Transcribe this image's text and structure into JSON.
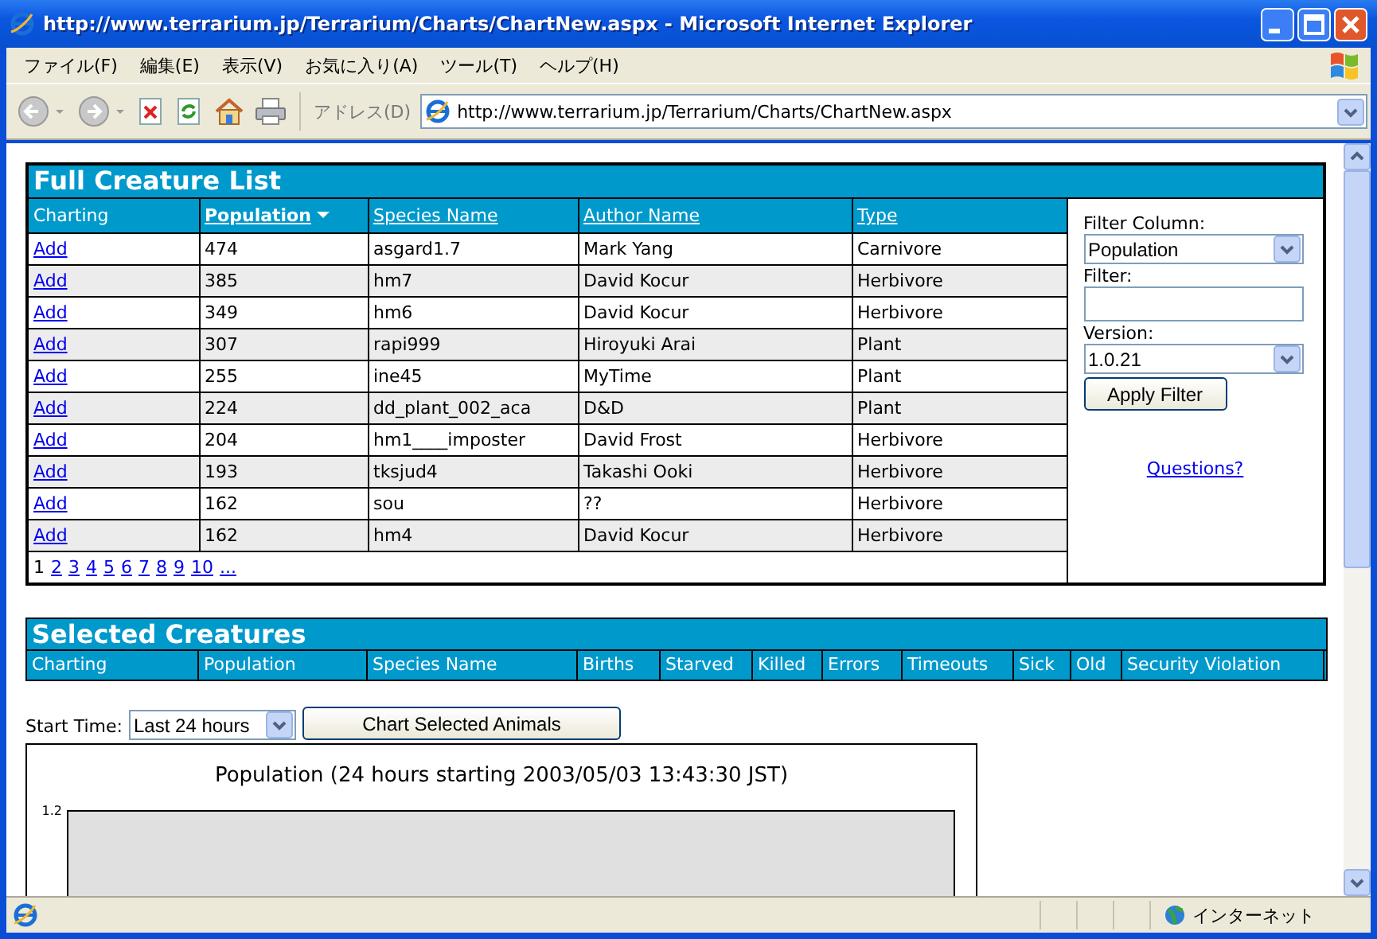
{
  "window": {
    "title": "http://www.terrarium.jp/Terrarium/Charts/ChartNew.aspx - Microsoft Internet Explorer"
  },
  "menu": [
    "ファイル(F)",
    "編集(E)",
    "表示(V)",
    "お気に入り(A)",
    "ツール(T)",
    "ヘルプ(H)"
  ],
  "toolbar": {
    "address_label": "アドレス(D)",
    "address": "http://www.terrarium.jp/Terrarium/Charts/ChartNew.aspx"
  },
  "creature_list": {
    "title": "Full Creature List",
    "columns": [
      {
        "label": "Charting",
        "link": false,
        "sorted": false
      },
      {
        "label": "Population",
        "link": true,
        "sorted": true
      },
      {
        "label": "Species Name",
        "link": true,
        "sorted": false
      },
      {
        "label": "Author Name",
        "link": true,
        "sorted": false
      },
      {
        "label": "Type",
        "link": true,
        "sorted": false
      }
    ],
    "rows": [
      {
        "action": "Add",
        "population": "474",
        "species": "asgard1.7",
        "author": "Mark Yang",
        "type": "Carnivore"
      },
      {
        "action": "Add",
        "population": "385",
        "species": "hm7",
        "author": "David Kocur",
        "type": "Herbivore"
      },
      {
        "action": "Add",
        "population": "349",
        "species": "hm6",
        "author": "David Kocur",
        "type": "Herbivore"
      },
      {
        "action": "Add",
        "population": "307",
        "species": "rapi999",
        "author": "Hiroyuki Arai",
        "type": "Plant"
      },
      {
        "action": "Add",
        "population": "255",
        "species": "ine45",
        "author": "MyTime",
        "type": "Plant"
      },
      {
        "action": "Add",
        "population": "224",
        "species": "dd_plant_002_aca",
        "author": "D&D",
        "type": "Plant"
      },
      {
        "action": "Add",
        "population": "204",
        "species": "hm1____imposter",
        "author": "David Frost",
        "type": "Herbivore"
      },
      {
        "action": "Add",
        "population": "193",
        "species": "tksjud4",
        "author": "Takashi Ooki",
        "type": "Herbivore"
      },
      {
        "action": "Add",
        "population": "162",
        "species": "sou",
        "author": "??",
        "type": "Herbivore"
      },
      {
        "action": "Add",
        "population": "162",
        "species": "hm4",
        "author": "David Kocur",
        "type": "Herbivore"
      }
    ],
    "pages": [
      {
        "label": "1",
        "selected": true
      },
      {
        "label": "2",
        "selected": false
      },
      {
        "label": "3",
        "selected": false
      },
      {
        "label": "4",
        "selected": false
      },
      {
        "label": "5",
        "selected": false
      },
      {
        "label": "6",
        "selected": false
      },
      {
        "label": "7",
        "selected": false
      },
      {
        "label": "8",
        "selected": false
      },
      {
        "label": "9",
        "selected": false
      },
      {
        "label": "10",
        "selected": false
      },
      {
        "label": "...",
        "selected": false
      }
    ]
  },
  "filter": {
    "column_label": "Filter Column:",
    "column_value": "Population",
    "filter_label": "Filter:",
    "version_label": "Version:",
    "version_value": "1.0.21",
    "apply": "Apply Filter",
    "questions": "Questions?"
  },
  "selected_creatures": {
    "title": "Selected Creatures",
    "columns": [
      "Charting",
      "Population",
      "Species Name",
      "Births",
      "Starved",
      "Killed",
      "Errors",
      "Timeouts",
      "Sick",
      "Old",
      "Security Violation"
    ]
  },
  "chart_controls": {
    "start_label": "Start Time:",
    "start_value": "Last 24 hours",
    "button": "Chart Selected Animals"
  },
  "chart": {
    "title": "Population (24 hours starting 2003/05/03 13:43:30 JST)",
    "y_tick": "1.2"
  },
  "status_bar": {
    "zone": "インターネット"
  }
}
